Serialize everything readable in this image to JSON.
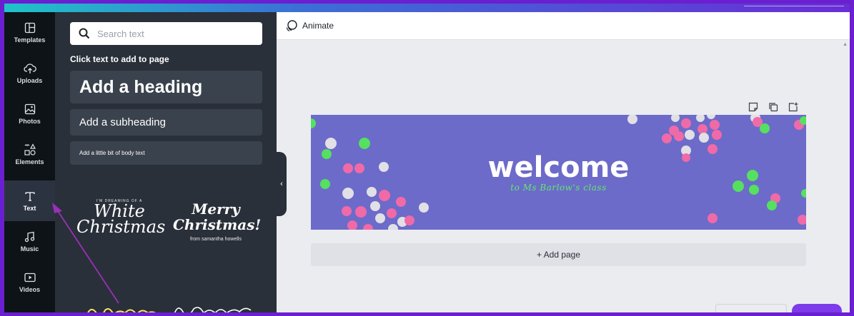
{
  "colors": {
    "frame_border": "#6a1fd0",
    "rail_bg": "#0e1318",
    "panel_bg": "#293039",
    "canvas_bg": "#6c6bc9",
    "accent_green": "#61e86d",
    "annotation_arrow": "#9b2fb8"
  },
  "rail": {
    "items": [
      {
        "label": "Templates",
        "icon": "templates-icon"
      },
      {
        "label": "Uploads",
        "icon": "upload-cloud-icon"
      },
      {
        "label": "Photos",
        "icon": "image-icon"
      },
      {
        "label": "Elements",
        "icon": "shapes-icon"
      },
      {
        "label": "Text",
        "icon": "text-t-icon",
        "active": true
      },
      {
        "label": "Music",
        "icon": "music-note-icon"
      },
      {
        "label": "Videos",
        "icon": "video-play-icon"
      }
    ]
  },
  "panel": {
    "search_placeholder": "Search text",
    "hint": "Click text to add to page",
    "add_heading": "Add a heading",
    "add_subheading": "Add a subheading",
    "add_body": "Add a little bit of body text",
    "templates": [
      {
        "small": "I'M DREAMING OF A",
        "big": "White Christmas"
      },
      {
        "big": "Merry Christmas!",
        "small": "from samantha howells"
      }
    ]
  },
  "editor": {
    "animate_label": "Animate",
    "add_page_label": "+ Add page",
    "canvas": {
      "title": "welcome",
      "subtitle": "to Ms Barlow's class"
    }
  }
}
